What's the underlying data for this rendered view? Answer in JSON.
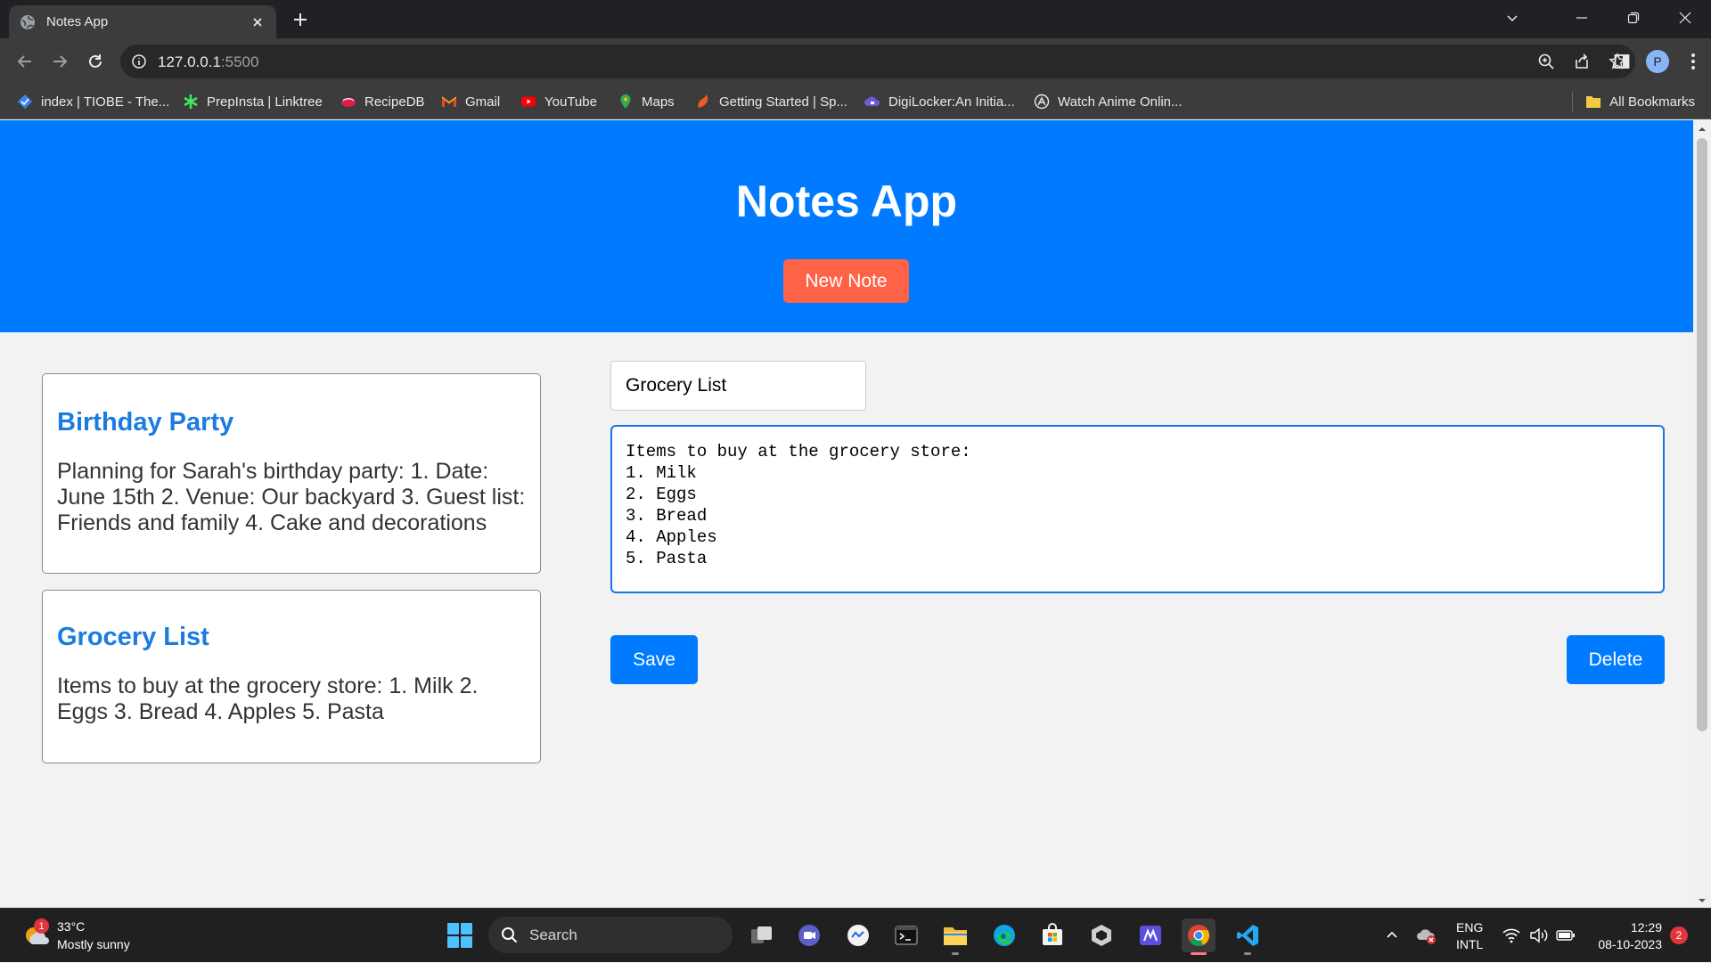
{
  "browser": {
    "tab_title": "Notes App",
    "url_host": "127.0.0.1",
    "url_port": ":5500",
    "profile_initial": "P",
    "bookmarks": [
      {
        "label": "index | TIOBE - The...",
        "icon": "tiobe-icon"
      },
      {
        "label": "PrepInsta | Linktree",
        "icon": "linktree-icon"
      },
      {
        "label": "RecipeDB",
        "icon": "recipedb-icon"
      },
      {
        "label": "Gmail",
        "icon": "gmail-icon"
      },
      {
        "label": "YouTube",
        "icon": "youtube-icon"
      },
      {
        "label": "Maps",
        "icon": "maps-icon"
      },
      {
        "label": "Getting Started | Sp...",
        "icon": "spring-icon"
      },
      {
        "label": "DigiLocker:An Initia...",
        "icon": "digilocker-icon"
      },
      {
        "label": "Watch Anime Onlin...",
        "icon": "anime-icon"
      }
    ],
    "all_bookmarks_label": "All Bookmarks"
  },
  "app": {
    "title": "Notes App",
    "new_note_label": "New Note",
    "accent_color": "#007bff",
    "new_note_color": "#ff6347",
    "notes": [
      {
        "title": "Birthday Party",
        "body": "Planning for Sarah's birthday party: 1. Date: June 15th 2. Venue: Our backyard 3. Guest list: Friends and family 4. Cake and decorations"
      },
      {
        "title": "Grocery List",
        "body": "Items to buy at the grocery store: 1. Milk 2. Eggs 3. Bread 4. Apples 5. Pasta"
      }
    ],
    "editor": {
      "title_value": "Grocery List",
      "body_value": "Items to buy at the grocery store:\n1. Milk\n2. Eggs\n3. Bread\n4. Apples\n5. Pasta",
      "save_label": "Save",
      "delete_label": "Delete"
    }
  },
  "taskbar": {
    "weather_temp": "33°C",
    "weather_desc": "Mostly sunny",
    "weather_badge": "1",
    "search_label": "Search",
    "lang_line1": "ENG",
    "lang_line2": "INTL",
    "time": "12:29",
    "date": "08-10-2023",
    "notification_count": "2"
  }
}
